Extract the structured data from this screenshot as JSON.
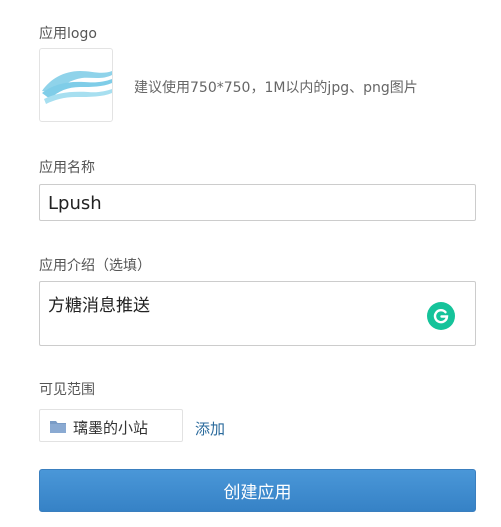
{
  "form": {
    "logo": {
      "label": "应用logo",
      "hint": "建议使用750*750，1M以内的jpg、png图片"
    },
    "name": {
      "label": "应用名称",
      "value": "Lpush"
    },
    "description": {
      "label": "应用介绍（选填）",
      "value": "方糖消息推送",
      "assistant_icon": "grammarly-icon"
    },
    "visibility": {
      "label": "可见范围",
      "chip_icon": "folder-icon",
      "chip_label": "璃墨的小站",
      "add_label": "添加"
    },
    "submit_label": "创建应用"
  },
  "colors": {
    "primary": "#3a8ad0",
    "link": "#2a6a9c",
    "grammarly": "#15c39a",
    "logo_wave": "#7fcde8"
  }
}
